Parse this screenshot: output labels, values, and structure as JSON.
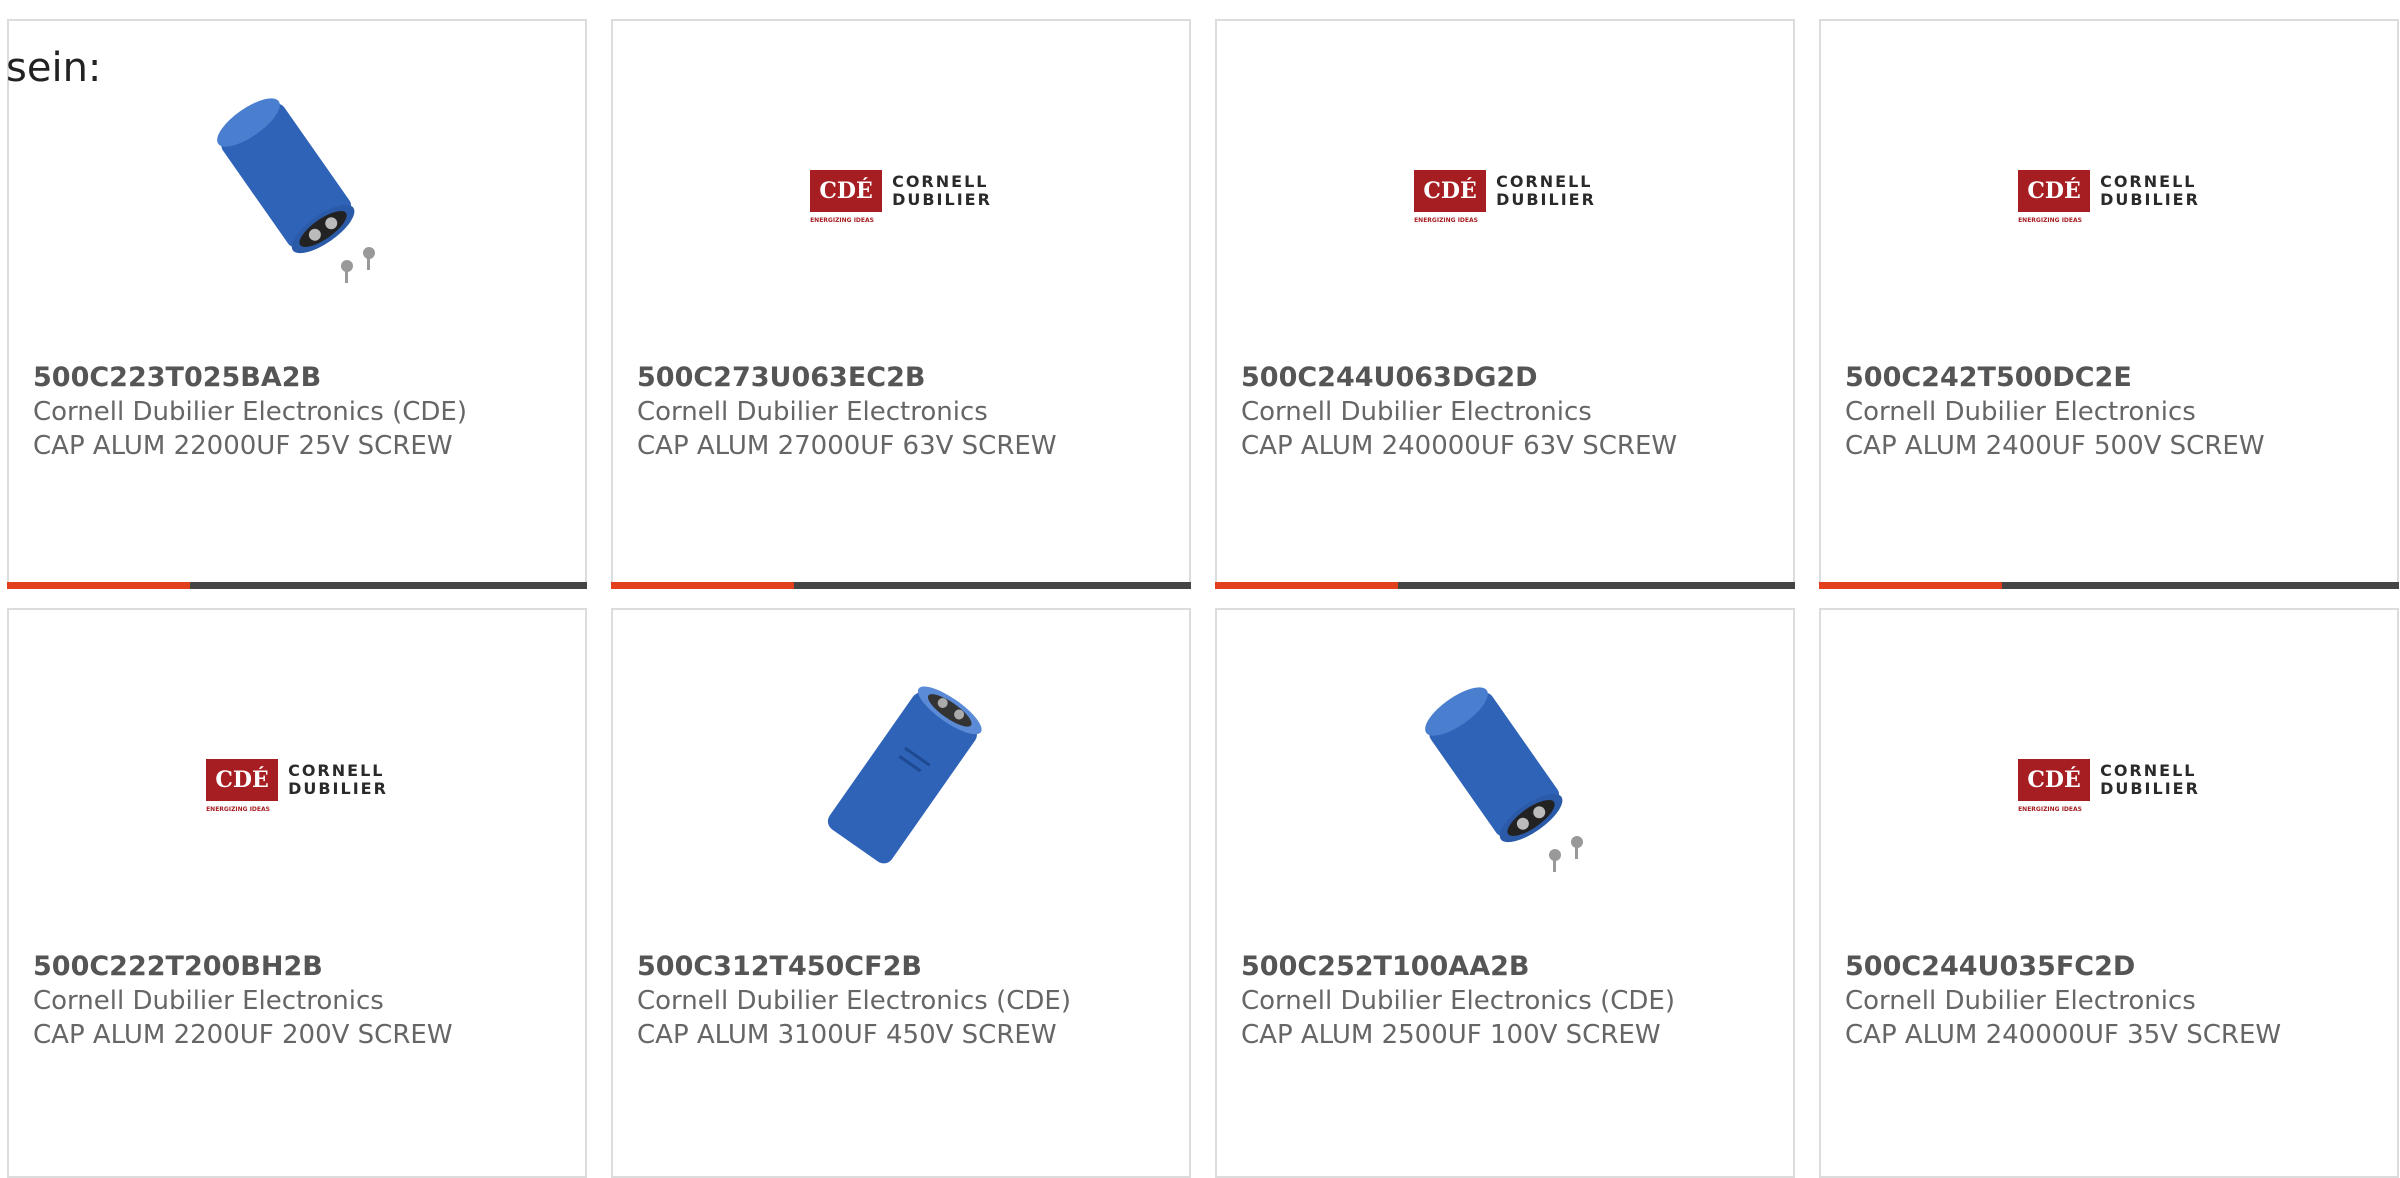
{
  "intro_text": "sein:",
  "colors": {
    "accent": "#e2401c",
    "bar": "#444444",
    "logo_red": "#a61e22",
    "capacitor_blue": "#2f63b8"
  },
  "logo": {
    "mark": "CDÉ",
    "line1": "CORNELL",
    "line2": "DUBILIER",
    "tagline": "ENERGIZING IDEAS"
  },
  "products": [
    {
      "image": "capacitor-screws",
      "part_number": "500C223T025BA2B",
      "manufacturer": "Cornell Dubilier Electronics (CDE)",
      "description": "CAP ALUM 22000UF 25V SCREW"
    },
    {
      "image": "cde-logo",
      "part_number": "500C273U063EC2B",
      "manufacturer": "Cornell Dubilier Electronics",
      "description": "CAP ALUM 27000UF 63V SCREW"
    },
    {
      "image": "cde-logo",
      "part_number": "500C244U063DG2D",
      "manufacturer": "Cornell Dubilier Electronics",
      "description": "CAP ALUM 240000UF 63V SCREW"
    },
    {
      "image": "cde-logo",
      "part_number": "500C242T500DC2E",
      "manufacturer": "Cornell Dubilier Electronics",
      "description": "CAP ALUM 2400UF 500V SCREW"
    },
    {
      "image": "cde-logo",
      "part_number": "500C222T200BH2B",
      "manufacturer": "Cornell Dubilier Electronics",
      "description": "CAP ALUM 2200UF 200V SCREW"
    },
    {
      "image": "capacitor-tilted",
      "part_number": "500C312T450CF2B",
      "manufacturer": "Cornell Dubilier Electronics (CDE)",
      "description": "CAP ALUM 3100UF 450V SCREW"
    },
    {
      "image": "capacitor-screws",
      "part_number": "500C252T100AA2B",
      "manufacturer": "Cornell Dubilier Electronics (CDE)",
      "description": "CAP ALUM 2500UF 100V SCREW"
    },
    {
      "image": "cde-logo",
      "part_number": "500C244U035FC2D",
      "manufacturer": "Cornell Dubilier Electronics",
      "description": "CAP ALUM 240000UF 35V SCREW"
    }
  ]
}
